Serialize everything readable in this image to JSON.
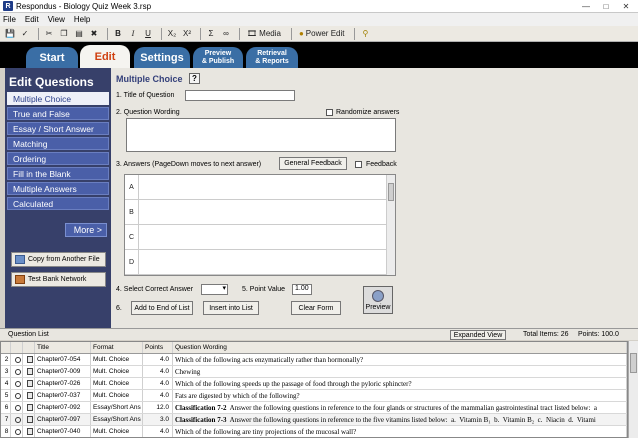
{
  "window": {
    "title": "Respondus - Biology Quiz Week 3.rsp",
    "icon_letter": "R"
  },
  "menu": [
    "File",
    "Edit",
    "View",
    "Help"
  ],
  "toolbar": {
    "media_label": "Media",
    "poweredit_label": "Power Edit"
  },
  "tabs": [
    {
      "label": "Start"
    },
    {
      "label": "Edit"
    },
    {
      "label": "Settings"
    },
    {
      "label_line1": "Preview",
      "label_line2": "& Publish"
    },
    {
      "label_line1": "Retrieval",
      "label_line2": "& Reports"
    }
  ],
  "sidebar": {
    "title": "Edit Questions",
    "items": [
      "Multiple Choice",
      "True and False",
      "Essay / Short Answer",
      "Matching",
      "Ordering",
      "Fill in the Blank",
      "Multiple Answers",
      "Calculated"
    ],
    "more_label": "More >",
    "copy_label": "Copy from Another File",
    "testbank_label": "Test Bank Network"
  },
  "form": {
    "heading": "Multiple Choice",
    "help": "?",
    "title_label": "1.  Title of Question",
    "wording_label": "2.  Question Wording",
    "randomize_label": "Randomize answers",
    "answers_label": "3.  Answers  (PageDown moves to next answer)",
    "general_feedback_label": "General Feedback",
    "feedback_label": "Feedback",
    "answer_letters": [
      "A",
      "B",
      "C",
      "D"
    ],
    "select_correct_label": "4.  Select Correct Answer",
    "point_value_label": "5.  Point Value",
    "point_value": "1.00",
    "step6_label": "6.",
    "add_end_label": "Add to End of List",
    "insert_label": "Insert into List",
    "clear_label": "Clear Form",
    "preview_label": "Preview"
  },
  "question_list": {
    "title": "Question List",
    "expanded_label": "Expanded View",
    "total_items": "Total Items: 26",
    "points": "Points: 100.0",
    "columns": [
      "",
      "",
      "",
      "Title",
      "Format",
      "Points",
      "Question Wording"
    ],
    "rows": [
      {
        "num": "2",
        "title": "Chapter07-054",
        "format": "Mult. Choice",
        "points": "4.0",
        "wording": "Which of the following acts enzymatically rather than hormonally?"
      },
      {
        "num": "3",
        "title": "Chapter07-009",
        "format": "Mult. Choice",
        "points": "4.0",
        "wording": "Chewing"
      },
      {
        "num": "4",
        "title": "Chapter07-026",
        "format": "Mult. Choice",
        "points": "4.0",
        "wording": "Which of the following speeds up the passage of food through the pyloric sphincter?"
      },
      {
        "num": "5",
        "title": "Chapter07-037",
        "format": "Mult. Choice",
        "points": "4.0",
        "wording": "Fats are digested by which of the following?"
      },
      {
        "num": "6",
        "title": "Chapter07-092",
        "format": "Essay/Short Ans",
        "points": "12.0",
        "wording_bold": "Classification 7-2",
        "wording": "  Answer the following questions in reference to the four glands or structures of the mammalian gastrointestinal tract listed below:  a"
      },
      {
        "num": "7",
        "title": "Chapter07-097",
        "format": "Essay/Short Ans",
        "points": "3.0",
        "wording_bold": "Classification 7-3",
        "wording": "  Answer the following questions in reference to the five vitamins listed below:  a.  Vitamin B₁  b.  Vitamin B₂  c.  Niacin  d.  Vitami"
      },
      {
        "num": "8",
        "title": "Chapter07-040",
        "format": "Mult. Choice",
        "points": "4.0",
        "wording": "Which of the following are tiny projections of the mucosal wall?"
      }
    ]
  }
}
